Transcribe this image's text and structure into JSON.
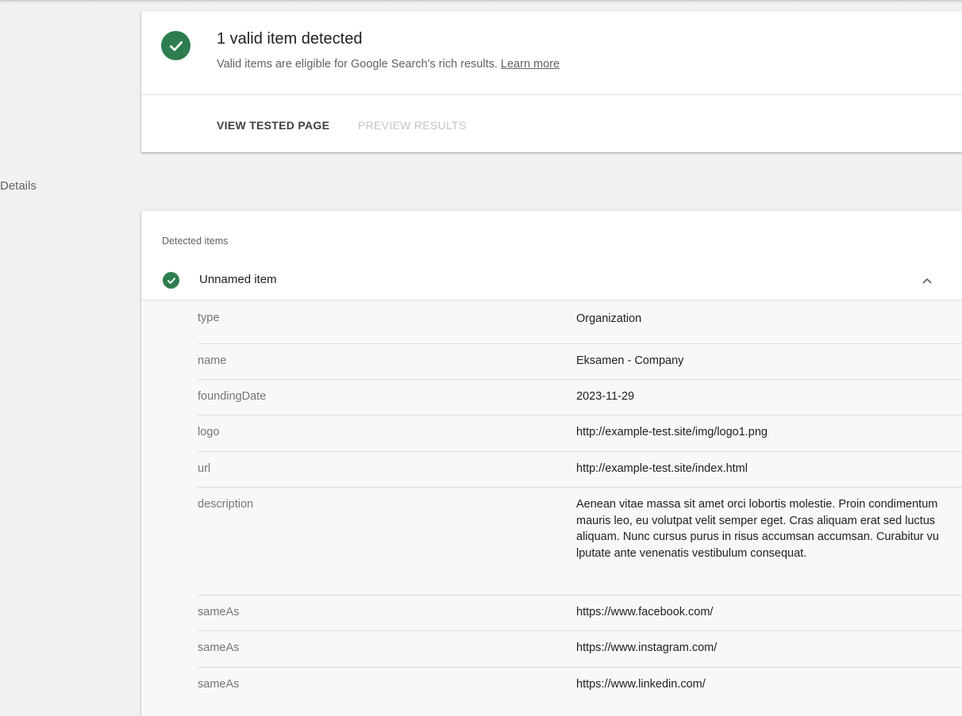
{
  "summary": {
    "title": "1 valid item detected",
    "subtitle": "Valid items are eligible for Google Search's rich results.",
    "learn_more": "Learn more",
    "tabs": [
      {
        "label": "VIEW TESTED PAGE",
        "active": true
      },
      {
        "label": "PREVIEW RESULTS",
        "active": false
      }
    ]
  },
  "details": {
    "section_label": "Details",
    "detected_label": "Detected items",
    "item": {
      "name": "Unnamed item",
      "status": "valid",
      "expanded": true
    },
    "properties": [
      {
        "key": "type",
        "value": "Organization"
      },
      {
        "key": "name",
        "value": "Eksamen - Company"
      },
      {
        "key": "foundingDate",
        "value": "2023-11-29"
      },
      {
        "key": "logo",
        "value": "http://example-test.site/img/logo1.png"
      },
      {
        "key": "url",
        "value": "http://example-test.site/index.html"
      },
      {
        "key": "description",
        "value": "Aenean vitae massa sit amet orci lobortis molestie. Proin condimentum mauris leo, eu volutpat velit semper eget. Cras aliquam erat sed luctus aliquam. Nunc cursus purus in risus accumsan accumsan. Curabitur vulputate ante venenatis vestibulum consequat."
      },
      {
        "key": "sameAs",
        "value": "https://www.facebook.com/"
      },
      {
        "key": "sameAs",
        "value": "https://www.instagram.com/"
      },
      {
        "key": "sameAs",
        "value": "https://www.linkedin.com/"
      }
    ]
  },
  "colors": {
    "valid_green": "#2e7d4f",
    "background": "#f1f1f1",
    "card": "#ffffff",
    "props_background": "#f8f8f8"
  },
  "icons": {
    "status": "check-circle-icon",
    "collapse": "chevron-up-icon"
  }
}
